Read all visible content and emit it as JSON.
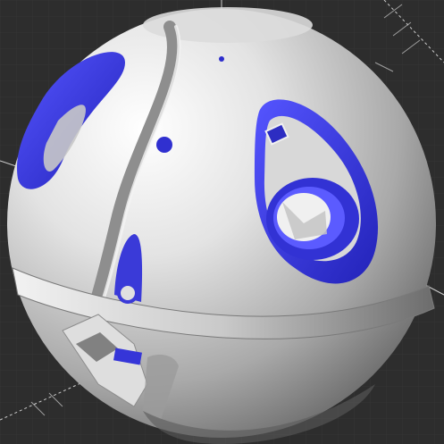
{
  "viewport": {
    "background_color": "#2d2d2d",
    "object_color_primary": "#d6d6d6",
    "object_color_cut_face": "#3a3ae0",
    "axis_color": "#e8e8e8",
    "icons": [
      "axis-x-icon",
      "axis-y-icon",
      "axis-z-icon"
    ]
  }
}
